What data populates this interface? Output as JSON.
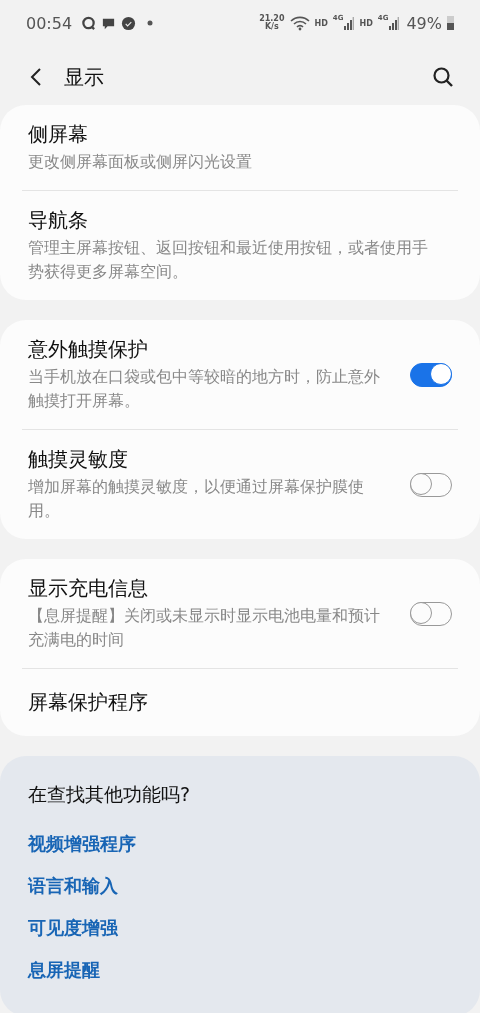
{
  "status_bar": {
    "time": "00:54",
    "speed": [
      "21.20",
      "K/s"
    ],
    "network": [
      {
        "label": "HD",
        "gen": "4G"
      },
      {
        "label": "HD",
        "gen": "4G"
      }
    ],
    "battery": "49%"
  },
  "header": {
    "title": "显示"
  },
  "groups": [
    {
      "items": [
        {
          "kind": "text",
          "title": "侧屏幕",
          "subtitle": "更改侧屏幕面板或侧屏闪光设置"
        },
        {
          "kind": "text",
          "title": "导航条",
          "subtitle": "管理主屏幕按钮、返回按钮和最近使用按钮，或者使用手势获得更多屏幕空间。"
        }
      ]
    },
    {
      "items": [
        {
          "kind": "switch",
          "title": "意外触摸保护",
          "subtitle": "当手机放在口袋或包中等较暗的地方时，防止意外触摸打开屏幕。",
          "on": true
        },
        {
          "kind": "switch",
          "title": "触摸灵敏度",
          "subtitle": "增加屏幕的触摸灵敏度，以便通过屏幕保护膜使用。",
          "on": false
        }
      ]
    },
    {
      "items": [
        {
          "kind": "switch",
          "title": "显示充电信息",
          "subtitle": "【息屏提醒】关闭或未显示时显示电池电量和预计充满电的时间",
          "on": false
        },
        {
          "kind": "text",
          "title": "屏幕保护程序"
        }
      ]
    }
  ],
  "suggestions": {
    "heading": "在查找其他功能吗?",
    "links": [
      "视频增强程序",
      "语言和输入",
      "可见度增强",
      "息屏提醒"
    ]
  }
}
